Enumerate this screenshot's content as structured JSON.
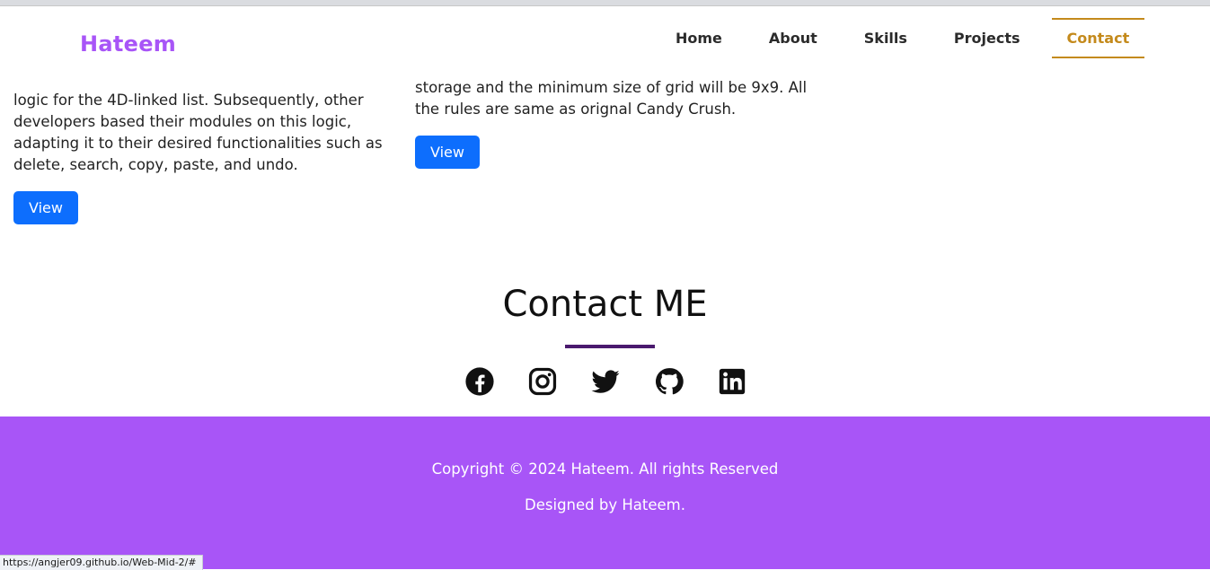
{
  "navbar": {
    "brand": "Hateem",
    "items": [
      {
        "label": "Home"
      },
      {
        "label": "About"
      },
      {
        "label": "Skills"
      },
      {
        "label": "Projects"
      },
      {
        "label": "Contact"
      }
    ],
    "active": "Contact"
  },
  "projects": [
    {
      "description": "logic for the 4D-linked list. Subsequently, other developers based their modules on this logic, adapting it to their desired functionalities such as delete, search, copy, paste, and undo.",
      "button_label": "View"
    },
    {
      "description": "storage and the minimum size of grid will be 9x9. All the rules are same as orignal Candy Crush.",
      "button_label": "View"
    }
  ],
  "contact": {
    "title": "Contact ME",
    "socials": [
      "facebook-icon",
      "instagram-icon",
      "twitter-icon",
      "github-icon",
      "linkedin-icon"
    ]
  },
  "footer": {
    "copyright": "Copyright © 2024 Hateem. All rights Reserved",
    "designed_by": "Designed by Hateem."
  },
  "status_bar": {
    "url": "https://angjer09.github.io/Web-Mid-2/#"
  },
  "colors": {
    "brand": "#a855f7",
    "active_nav": "#c48a1c",
    "button": "#0d6efd",
    "footer_bg": "#a855f7",
    "divider": "#4a1a6e"
  }
}
